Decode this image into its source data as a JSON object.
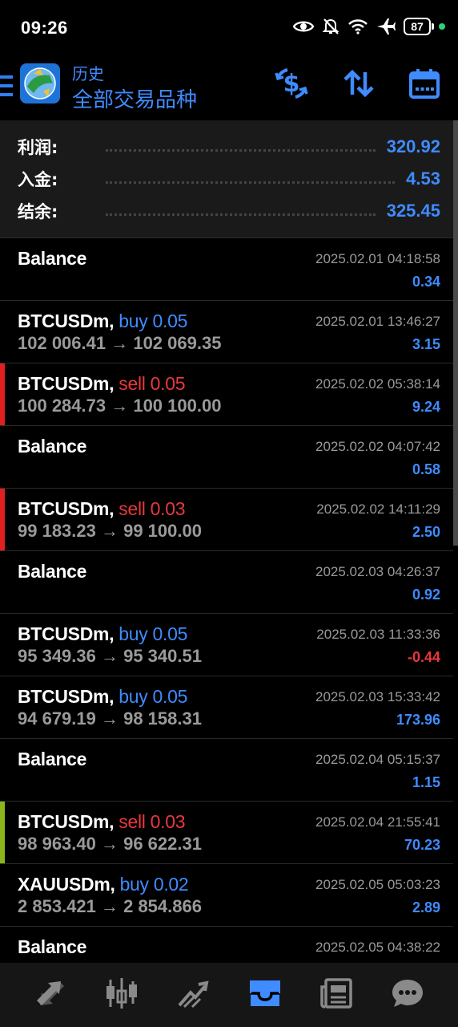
{
  "status_bar": {
    "time": "09:26",
    "battery": "87",
    "icons": [
      "eye-icon",
      "bell-off-icon",
      "wifi-icon",
      "airplane-icon",
      "battery-icon"
    ]
  },
  "app_bar": {
    "subtitle": "历史",
    "title": "全部交易品种",
    "actions": [
      "currency-exchange-icon",
      "sort-icon",
      "calendar-icon"
    ],
    "accent_color": "#3f8bff"
  },
  "summary": {
    "rows": [
      {
        "label": "利润:",
        "value": "320.92"
      },
      {
        "label": "入金:",
        "value": "4.53"
      },
      {
        "label": "结余:",
        "value": "325.45"
      }
    ]
  },
  "deals": [
    {
      "symbol": "Balance",
      "type": "",
      "prices": "",
      "time": "2025.02.01 04:18:58",
      "profit": "0.34",
      "profit_color": "#3f8bff",
      "accent": ""
    },
    {
      "symbol": "BTCUSDm,",
      "type": "buy 0.05",
      "type_color": "#3f8bff",
      "prices": "102 006.41 → 102 069.35",
      "time": "2025.02.01 13:46:27",
      "profit": "3.15",
      "profit_color": "#3f8bff",
      "accent": ""
    },
    {
      "symbol": "BTCUSDm,",
      "type": "sell 0.05",
      "type_color": "#e8383d",
      "prices": "100 284.73 → 100 100.00",
      "time": "2025.02.02 05:38:14",
      "profit": "9.24",
      "profit_color": "#3f8bff",
      "accent": "#e02020"
    },
    {
      "symbol": "Balance",
      "type": "",
      "prices": "",
      "time": "2025.02.02 04:07:42",
      "profit": "0.58",
      "profit_color": "#3f8bff",
      "accent": ""
    },
    {
      "symbol": "BTCUSDm,",
      "type": "sell 0.03",
      "type_color": "#e8383d",
      "prices": "99 183.23 → 99 100.00",
      "time": "2025.02.02 14:11:29",
      "profit": "2.50",
      "profit_color": "#3f8bff",
      "accent": "#e02020"
    },
    {
      "symbol": "Balance",
      "type": "",
      "prices": "",
      "time": "2025.02.03 04:26:37",
      "profit": "0.92",
      "profit_color": "#3f8bff",
      "accent": ""
    },
    {
      "symbol": "BTCUSDm,",
      "type": "buy 0.05",
      "type_color": "#3f8bff",
      "prices": "95 349.36 → 95 340.51",
      "time": "2025.02.03 11:33:36",
      "profit": "-0.44",
      "profit_color": "#e8383d",
      "accent": ""
    },
    {
      "symbol": "BTCUSDm,",
      "type": "buy 0.05",
      "type_color": "#3f8bff",
      "prices": "94 679.19 → 98 158.31",
      "time": "2025.02.03 15:33:42",
      "profit": "173.96",
      "profit_color": "#3f8bff",
      "accent": ""
    },
    {
      "symbol": "Balance",
      "type": "",
      "prices": "",
      "time": "2025.02.04 05:15:37",
      "profit": "1.15",
      "profit_color": "#3f8bff",
      "accent": ""
    },
    {
      "symbol": "BTCUSDm,",
      "type": "sell 0.03",
      "type_color": "#e8383d",
      "prices": "98 963.40 → 96 622.31",
      "time": "2025.02.04 21:55:41",
      "profit": "70.23",
      "profit_color": "#3f8bff",
      "accent": "#8ab61c"
    },
    {
      "symbol": "XAUUSDm,",
      "type": "buy 0.02",
      "type_color": "#3f8bff",
      "prices": "2 853.421 → 2 854.866",
      "time": "2025.02.05 05:03:23",
      "profit": "2.89",
      "profit_color": "#3f8bff",
      "accent": ""
    },
    {
      "symbol": "Balance",
      "type": "",
      "prices": "",
      "time": "2025.02.05 04:38:22",
      "profit": "",
      "profit_color": "#3f8bff",
      "accent": ""
    }
  ],
  "bottom_nav": {
    "items": [
      "quotes-icon",
      "chart-icon",
      "trade-icon",
      "history-icon",
      "news-icon",
      "chat-icon"
    ],
    "active": "history-icon",
    "active_color": "#3f8bff",
    "inactive_color": "#8a8a8a"
  }
}
